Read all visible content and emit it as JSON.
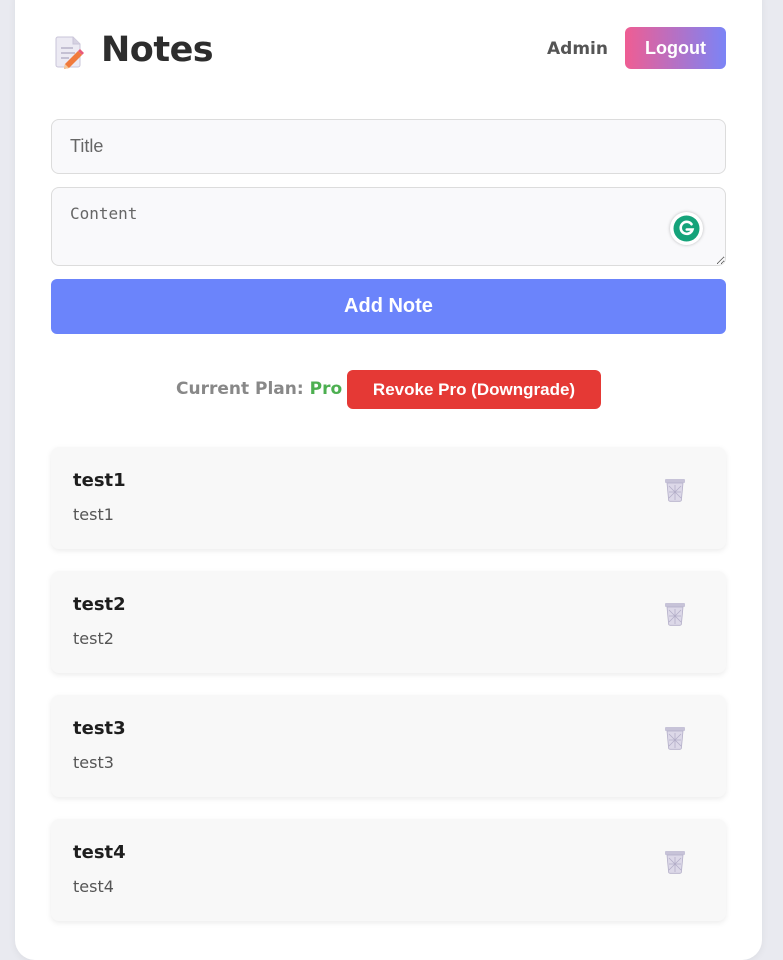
{
  "app": {
    "title": "Notes"
  },
  "header": {
    "user_name": "Admin",
    "logout_label": "Logout"
  },
  "form": {
    "title_placeholder": "Title",
    "title_value": "",
    "content_placeholder": "Content",
    "content_value": "",
    "add_label": "Add Note"
  },
  "plan": {
    "label": "Current Plan:",
    "value": "Pro",
    "revoke_label": "Revoke Pro (Downgrade)"
  },
  "notes": [
    {
      "title": "test1",
      "body": "test1"
    },
    {
      "title": "test2",
      "body": "test2"
    },
    {
      "title": "test3",
      "body": "test3"
    },
    {
      "title": "test4",
      "body": "test4"
    }
  ],
  "icons": {
    "title": "memo-icon",
    "grammarly": "grammarly-icon",
    "delete": "trash-icon"
  },
  "colors": {
    "primary": "#6b84fb",
    "danger": "#e53935",
    "plan_value": "#4caf50",
    "logout_from": "#ef5d93",
    "logout_to": "#7b84f6"
  }
}
